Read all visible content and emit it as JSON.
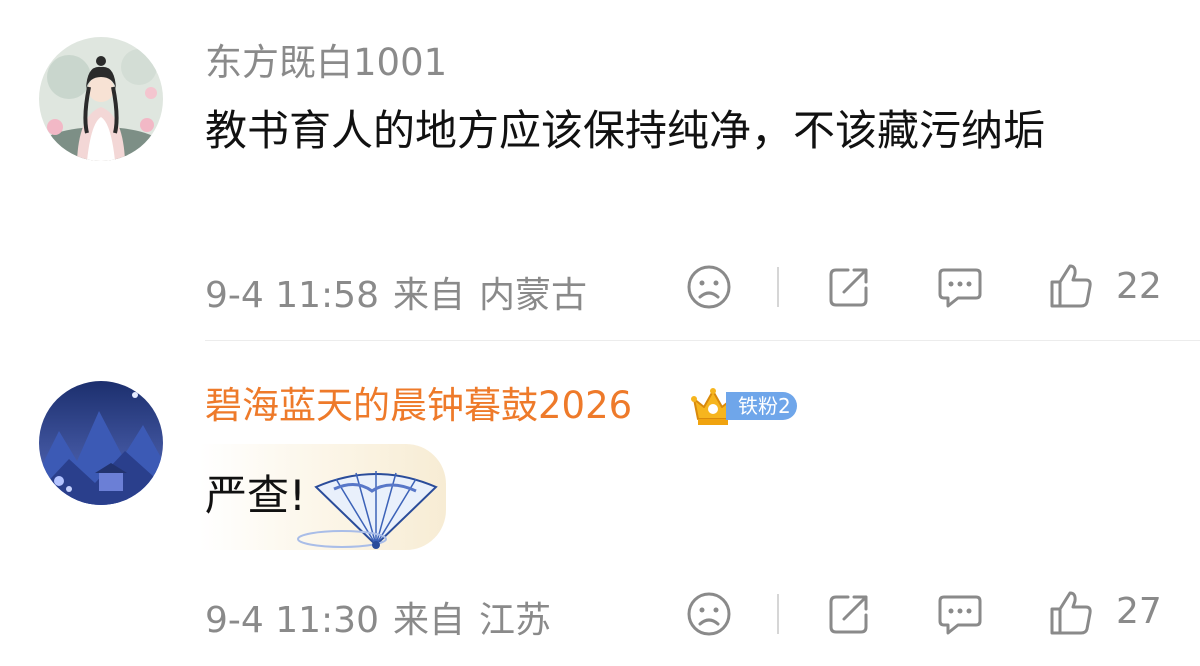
{
  "comments": [
    {
      "username": "东方既白1001",
      "text": "教书育人的地方应该保持纯净，不该藏污纳垢",
      "date": "9-4 11:58",
      "from_label": "来自",
      "location": "内蒙古",
      "likes": "22"
    },
    {
      "username": "碧海蓝天的晨钟暮鼓2026",
      "badge": "铁粉2",
      "text": "严查!",
      "date": "9-4 11:30",
      "from_label": "来自",
      "location": "江苏",
      "likes": "27"
    }
  ],
  "colors": {
    "username_default": "#8a8a8a",
    "username_vip": "#ee7a2a",
    "badge": "#6fa6ea",
    "text": "#111111",
    "meta": "#8a8a8a"
  },
  "icons": [
    "sad-face-icon",
    "share-icon",
    "comment-icon",
    "thumbs-up-icon"
  ]
}
